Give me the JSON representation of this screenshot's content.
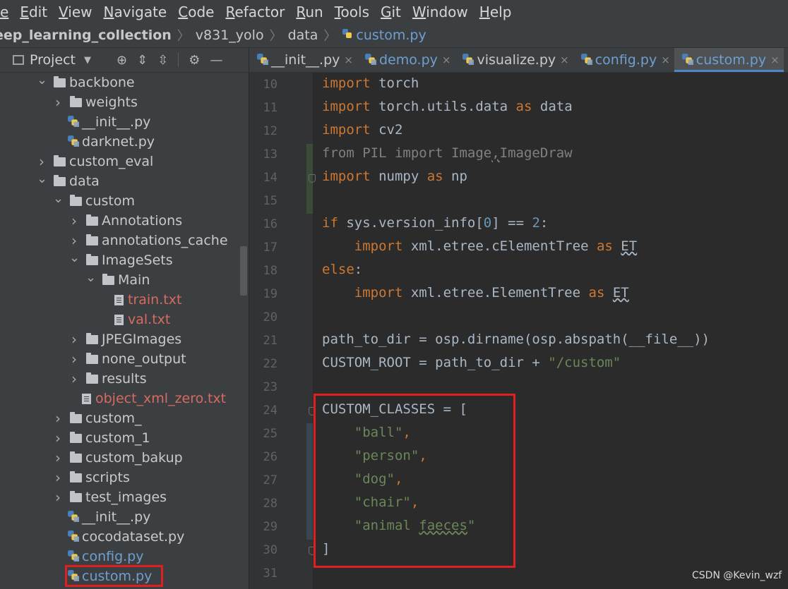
{
  "menu": [
    "e",
    "Edit",
    "View",
    "Navigate",
    "Code",
    "Refactor",
    "Run",
    "Tools",
    "Git",
    "Window",
    "Help"
  ],
  "breadcrumb": {
    "project": "eep_learning_collection",
    "items": [
      "v831_yolo",
      "data"
    ],
    "file": "custom.py"
  },
  "project_panel": {
    "title": "Project",
    "tree": [
      {
        "label": "backbone",
        "type": "folder",
        "depth": 1,
        "expanded": true
      },
      {
        "label": "weights",
        "type": "folder",
        "depth": 2,
        "expanded": false
      },
      {
        "label": "__init__.py",
        "type": "py",
        "depth": 2
      },
      {
        "label": "darknet.py",
        "type": "py",
        "depth": 2
      },
      {
        "label": "custom_eval",
        "type": "folder",
        "depth": 1,
        "expanded": false
      },
      {
        "label": "data",
        "type": "folder",
        "depth": 1,
        "expanded": true
      },
      {
        "label": "custom",
        "type": "folder",
        "depth": 2,
        "expanded": true
      },
      {
        "label": "Annotations",
        "type": "folder",
        "depth": 3,
        "expanded": false
      },
      {
        "label": "annotations_cache",
        "type": "folder",
        "depth": 3,
        "expanded": false
      },
      {
        "label": "ImageSets",
        "type": "folder",
        "depth": 3,
        "expanded": true
      },
      {
        "label": "Main",
        "type": "folder",
        "depth": 4,
        "expanded": true
      },
      {
        "label": "train.txt",
        "type": "txt",
        "depth": 5,
        "color": "red"
      },
      {
        "label": "val.txt",
        "type": "txt",
        "depth": 5,
        "color": "red"
      },
      {
        "label": "JPEGImages",
        "type": "folder",
        "depth": 3,
        "expanded": false
      },
      {
        "label": "none_output",
        "type": "folder",
        "depth": 3,
        "expanded": false
      },
      {
        "label": "results",
        "type": "folder",
        "depth": 3,
        "expanded": false
      },
      {
        "label": "object_xml_zero.txt",
        "type": "txt",
        "depth": 3,
        "color": "red"
      },
      {
        "label": "custom_",
        "type": "folder",
        "depth": 2,
        "expanded": false
      },
      {
        "label": "custom_1",
        "type": "folder",
        "depth": 2,
        "expanded": false
      },
      {
        "label": "custom_bakup",
        "type": "folder",
        "depth": 2,
        "expanded": false
      },
      {
        "label": "scripts",
        "type": "folder",
        "depth": 2,
        "expanded": false
      },
      {
        "label": "test_images",
        "type": "folder",
        "depth": 2,
        "expanded": false
      },
      {
        "label": "__init__.py",
        "type": "py",
        "depth": 2
      },
      {
        "label": "cocodataset.py",
        "type": "py",
        "depth": 2
      },
      {
        "label": "config.py",
        "type": "py",
        "depth": 2,
        "color": "blue"
      },
      {
        "label": "custom.py",
        "type": "py",
        "depth": 2,
        "color": "blue",
        "selected": true
      }
    ]
  },
  "tabs": [
    {
      "label": "__init__.py",
      "color": "normal"
    },
    {
      "label": "demo.py",
      "color": "blue"
    },
    {
      "label": "visualize.py",
      "color": "normal"
    },
    {
      "label": "config.py",
      "color": "blue"
    },
    {
      "label": "custom.py",
      "color": "blue",
      "active": true
    }
  ],
  "code": [
    {
      "n": "10",
      "tokens": [
        [
          "kw",
          "import"
        ],
        [
          "t",
          " torch"
        ]
      ]
    },
    {
      "n": "11",
      "tokens": [
        [
          "kw",
          "import"
        ],
        [
          "t",
          " torch.utils.data "
        ],
        [
          "kw",
          "as"
        ],
        [
          "t",
          " data"
        ]
      ]
    },
    {
      "n": "12",
      "tokens": [
        [
          "kw",
          "import"
        ],
        [
          "t",
          " cv2"
        ]
      ]
    },
    {
      "n": "13",
      "tokens": [
        [
          "gray",
          "from PIL import Image"
        ],
        [
          "wavy2",
          ","
        ],
        [
          "gray",
          "ImageDraw"
        ]
      ],
      "mark": "add"
    },
    {
      "n": "14",
      "tokens": [
        [
          "kw",
          "import"
        ],
        [
          "t",
          " numpy "
        ],
        [
          "kw",
          "as"
        ],
        [
          "t",
          " np"
        ]
      ],
      "mark": "add",
      "fold": true
    },
    {
      "n": "15",
      "tokens": [],
      "mark": "add"
    },
    {
      "n": "16",
      "tokens": [
        [
          "kw",
          "if"
        ],
        [
          "t",
          " sys.version_info["
        ],
        [
          "num",
          "0"
        ],
        [
          "t",
          "] == "
        ],
        [
          "num",
          "2"
        ],
        [
          "t",
          ":"
        ]
      ]
    },
    {
      "n": "17",
      "tokens": [
        [
          "t",
          "    "
        ],
        [
          "kw",
          "import"
        ],
        [
          "t",
          " xml.etree.cElementTree "
        ],
        [
          "kw",
          "as"
        ],
        [
          "t",
          " "
        ],
        [
          "wavyt",
          "ET"
        ]
      ]
    },
    {
      "n": "18",
      "tokens": [
        [
          "kw",
          "else"
        ],
        [
          "t",
          ":"
        ]
      ]
    },
    {
      "n": "19",
      "tokens": [
        [
          "t",
          "    "
        ],
        [
          "kw",
          "import"
        ],
        [
          "t",
          " xml.etree.ElementTree "
        ],
        [
          "kw",
          "as"
        ],
        [
          "t",
          " "
        ],
        [
          "wavyt",
          "ET"
        ]
      ]
    },
    {
      "n": "20",
      "tokens": []
    },
    {
      "n": "21",
      "tokens": [
        [
          "t",
          "path_to_dir = osp.dirname(osp.abspath(__file__))"
        ]
      ]
    },
    {
      "n": "22",
      "tokens": [
        [
          "t",
          "CUSTOM_ROOT = path_to_dir + "
        ],
        [
          "str",
          "\"/custom\""
        ]
      ]
    },
    {
      "n": "23",
      "tokens": []
    },
    {
      "n": "24",
      "tokens": [
        [
          "t",
          "CUSTOM_CLASSES = ["
        ]
      ],
      "fold": true
    },
    {
      "n": "25",
      "tokens": [
        [
          "t",
          "    "
        ],
        [
          "str",
          "\"ball\""
        ],
        [
          "kw",
          ","
        ]
      ],
      "mark": "mod"
    },
    {
      "n": "26",
      "tokens": [
        [
          "t",
          "    "
        ],
        [
          "str",
          "\"person\""
        ],
        [
          "kw",
          ","
        ]
      ],
      "mark": "mod"
    },
    {
      "n": "27",
      "tokens": [
        [
          "t",
          "    "
        ],
        [
          "str",
          "\"dog\""
        ],
        [
          "kw",
          ","
        ]
      ],
      "mark": "mod"
    },
    {
      "n": "28",
      "tokens": [
        [
          "t",
          "    "
        ],
        [
          "str",
          "\"chair\""
        ],
        [
          "kw",
          ","
        ]
      ],
      "mark": "mod"
    },
    {
      "n": "29",
      "tokens": [
        [
          "t",
          "    "
        ],
        [
          "str",
          "\"animal "
        ],
        [
          "wavy",
          "faeces"
        ],
        [
          "str",
          "\""
        ]
      ],
      "mark": "mod"
    },
    {
      "n": "30",
      "tokens": [
        [
          "t",
          "]"
        ]
      ],
      "fold": true
    },
    {
      "n": "31",
      "tokens": []
    }
  ],
  "watermark": "CSDN @Kevin_wzf"
}
